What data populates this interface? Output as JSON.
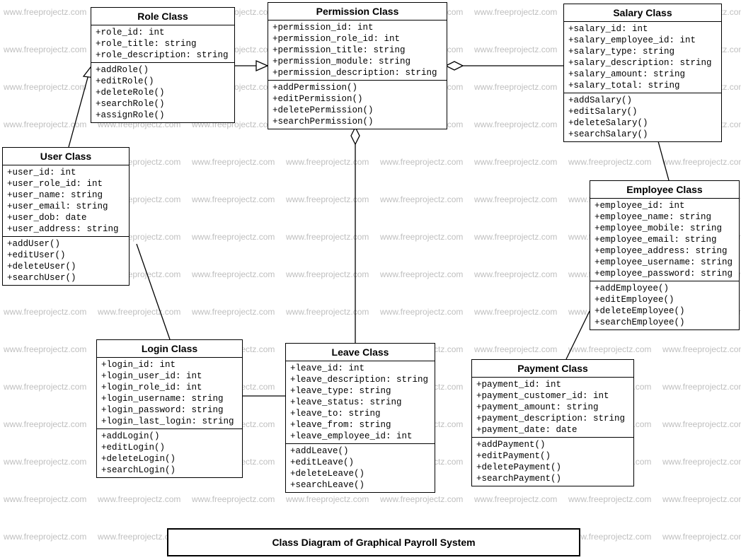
{
  "watermark": "www.freeprojectz.com",
  "caption": "Class Diagram of Graphical Payroll System",
  "classes": {
    "role": {
      "title": "Role Class",
      "attrs": [
        "+role_id: int",
        "+role_title: string",
        "+role_description: string"
      ],
      "ops": [
        "+addRole()",
        "+editRole()",
        "+deleteRole()",
        "+searchRole()",
        "+assignRole()"
      ]
    },
    "permission": {
      "title": "Permission Class",
      "attrs": [
        "+permission_id: int",
        "+permission_role_id: int",
        "+permission_title: string",
        "+permission_module: string",
        "+permission_description: string"
      ],
      "ops": [
        "+addPermission()",
        "+editPermission()",
        "+deletePermission()",
        "+searchPermission()"
      ]
    },
    "salary": {
      "title": "Salary Class",
      "attrs": [
        "+salary_id: int",
        "+salary_employee_id: int",
        "+salary_type: string",
        "+salary_description: string",
        "+salary_amount: string",
        "+salary_total: string"
      ],
      "ops": [
        "+addSalary()",
        "+editSalary()",
        "+deleteSalary()",
        "+searchSalary()"
      ]
    },
    "user": {
      "title": "User Class",
      "attrs": [
        "+user_id: int",
        "+user_role_id: int",
        "+user_name: string",
        "+user_email: string",
        "+user_dob: date",
        "+user_address: string"
      ],
      "ops": [
        "+addUser()",
        "+editUser()",
        "+deleteUser()",
        "+searchUser()"
      ]
    },
    "employee": {
      "title": "Employee Class",
      "attrs": [
        "+employee_id: int",
        "+employee_name: string",
        "+employee_mobile: string",
        "+employee_email: string",
        "+employee_address: string",
        "+employee_username: string",
        "+employee_password: string"
      ],
      "ops": [
        "+addEmployee()",
        "+editEmployee()",
        "+deleteEmployee()",
        "+searchEmployee()"
      ]
    },
    "login": {
      "title": "Login Class",
      "attrs": [
        "+login_id: int",
        "+login_user_id: int",
        "+login_role_id: int",
        "+login_username: string",
        "+login_password: string",
        "+login_last_login: string"
      ],
      "ops": [
        "+addLogin()",
        "+editLogin()",
        "+deleteLogin()",
        "+searchLogin()"
      ]
    },
    "leave": {
      "title": "Leave Class",
      "attrs": [
        "+leave_id: int",
        "+leave_description: string",
        "+leave_type: string",
        "+leave_status: string",
        "+leave_to: string",
        "+leave_from: string",
        "+leave_employee_id: int"
      ],
      "ops": [
        "+addLeave()",
        "+editLeave()",
        "+deleteLeave()",
        "+searchLeave()"
      ]
    },
    "payment": {
      "title": "Payment Class",
      "attrs": [
        "+payment_id: int",
        "+payment_customer_id: int",
        "+payment_amount: string",
        "+payment_description: string",
        "+payment_date: date"
      ],
      "ops": [
        "+addPayment()",
        "+editPayment()",
        "+deletePayment()",
        "+searchPayment()"
      ]
    }
  }
}
